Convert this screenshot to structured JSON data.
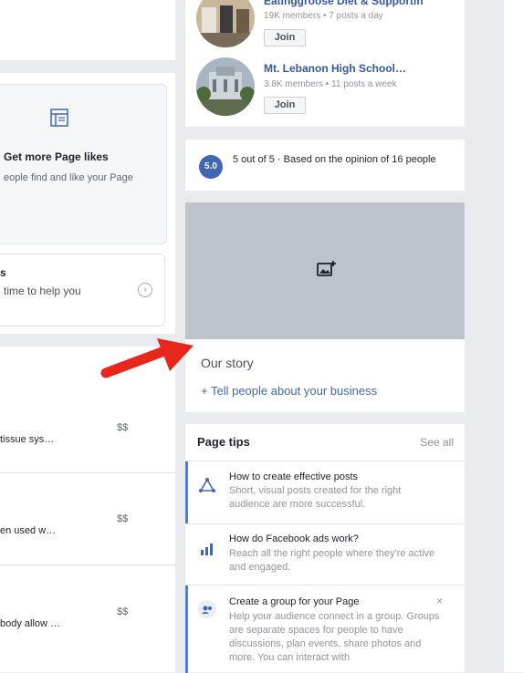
{
  "groups": [
    {
      "name": "Eatinggroose Diet & Supportin",
      "meta": "19K members • 7 posts a day",
      "join": "Join"
    },
    {
      "name": "Mt. Lebanon High School…",
      "meta": "3.8K members • 11 posts a week",
      "join": "Join"
    }
  ],
  "promo": {
    "title": "Get more Page likes",
    "desc": "eople find and like your Page"
  },
  "help": {
    "title": "s",
    "text": "time to help you"
  },
  "list": [
    {
      "text": "tissue sys…",
      "price": "$$"
    },
    {
      "text": "en used w…",
      "price": "$$"
    },
    {
      "text": "body allow …",
      "price": "$$"
    }
  ],
  "rating": {
    "score": "5.0",
    "text": "5 out of 5 · Based on the opinion of 16 people"
  },
  "story": {
    "title": "Our story",
    "link": "+ Tell people about your business"
  },
  "tips": {
    "header": "Page tips",
    "see_all": "See all",
    "items": [
      {
        "title": "How to create effective posts",
        "desc": "Short, visual posts created for the right audience are more successful.",
        "icon": "triangle-share-icon"
      },
      {
        "title": "How do Facebook ads work?",
        "desc": "Reach all the right people where they're active and engaged.",
        "icon": "bar-chart-icon"
      },
      {
        "title": "Create a group for your Page",
        "desc": "Help your audience connect in a group. Groups are separate spaces for people to have discussions, plan events, share photos and more. You can interact with",
        "icon": "group-icon",
        "close": "×"
      }
    ]
  },
  "colors": {
    "accent": "#4267b2",
    "link": "#365899",
    "tip_bar": "#4080ff",
    "arrow": "#e8261b"
  }
}
